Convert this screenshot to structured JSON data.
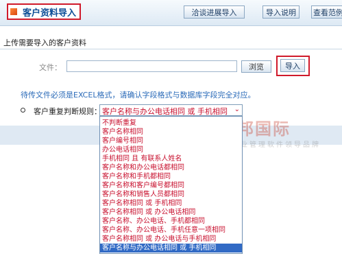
{
  "header": {
    "title": "客户资料导入",
    "buttons": {
      "progress_import": "洽谈进展导入",
      "import_guide": "导入说明",
      "view_example": "查看范例"
    }
  },
  "upload": {
    "section_title": "上传需要导入的客户资料",
    "file_label": "文件：",
    "file_value": "",
    "browse_label": "浏览",
    "import_label": "导入"
  },
  "notice": "待传文件必须是EXCEL格式，请确认字段格式与数据库字段完全对应。",
  "duplicate_rule": {
    "label": "客户重复判断规则：",
    "selected": "客户名称与办公电话相同 或 手机相同",
    "options": [
      "不判断重复",
      "客户名称相同",
      "客户编号相同",
      "办公电话相同",
      "手机相同 且 有联系人姓名",
      "客户名称和办公电话都相同",
      "客户名称和手机都相同",
      "客户名称和客户编号都相同",
      "客户名称和销售人员都相同",
      "客户名称相同 或 手机相同",
      "客户名称相同 或 办公电话相同",
      "客户名称、办公电话、手机都相同",
      "客户名称、办公电话、手机任意一项相同",
      "客户名称相同 或 办公电话与手机相同",
      "客户名称与办公电话相同 或 手机相同"
    ],
    "selected_index": 14
  },
  "watermark": {
    "name": "智邦国际",
    "slogan": "企业管理软件领导品牌"
  },
  "colors": {
    "highlight_red": "#d0192a",
    "option_text": "#c8102e",
    "selection_blue": "#316ac5",
    "notice_blue": "#2a6ab8"
  }
}
